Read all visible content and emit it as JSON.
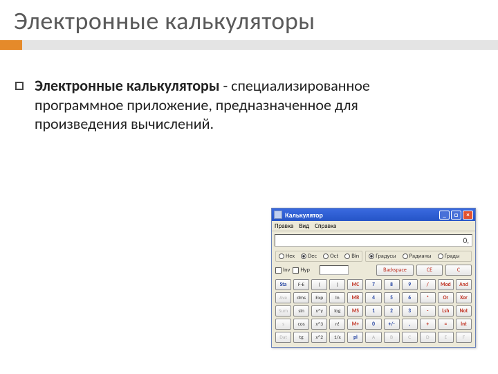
{
  "slide": {
    "title": "Электронные калькуляторы",
    "body_bold": "Электронные калькуляторы",
    "body_rest": " - специализированное программное приложение, предназначенное для произведения вычислений."
  },
  "calc": {
    "title": "Калькулятор",
    "menu": [
      "Правка",
      "Вид",
      "Справка"
    ],
    "display": "0,",
    "base": [
      {
        "label": "Hex",
        "sel": false
      },
      {
        "label": "Dec",
        "sel": true
      },
      {
        "label": "Oct",
        "sel": false
      },
      {
        "label": "Bin",
        "sel": false
      }
    ],
    "angle": [
      {
        "label": "Градусы",
        "sel": true
      },
      {
        "label": "Радианы",
        "sel": false
      },
      {
        "label": "Грады",
        "sel": false
      }
    ],
    "checks": [
      "Inv",
      "Hyp"
    ],
    "actions": [
      "Backspace",
      "CE",
      "C"
    ],
    "grid": [
      [
        {
          "t": "Sta",
          "c": "blue"
        },
        {
          "t": "F-E",
          "c": ""
        },
        {
          "t": "(",
          "c": ""
        },
        {
          "t": ")",
          "c": ""
        },
        {
          "t": "MC",
          "c": "red"
        },
        {
          "t": "7",
          "c": "blue"
        },
        {
          "t": "8",
          "c": "blue"
        },
        {
          "t": "9",
          "c": "blue"
        },
        {
          "t": "/",
          "c": "red"
        },
        {
          "t": "Mod",
          "c": "red"
        },
        {
          "t": "And",
          "c": "red"
        }
      ],
      [
        {
          "t": "Ave",
          "c": "dis"
        },
        {
          "t": "dms",
          "c": ""
        },
        {
          "t": "Exp",
          "c": ""
        },
        {
          "t": "ln",
          "c": ""
        },
        {
          "t": "MR",
          "c": "red"
        },
        {
          "t": "4",
          "c": "blue"
        },
        {
          "t": "5",
          "c": "blue"
        },
        {
          "t": "6",
          "c": "blue"
        },
        {
          "t": "*",
          "c": "red"
        },
        {
          "t": "Or",
          "c": "red"
        },
        {
          "t": "Xor",
          "c": "red"
        }
      ],
      [
        {
          "t": "Sum",
          "c": "dis"
        },
        {
          "t": "sin",
          "c": ""
        },
        {
          "t": "x^y",
          "c": ""
        },
        {
          "t": "log",
          "c": ""
        },
        {
          "t": "MS",
          "c": "red"
        },
        {
          "t": "1",
          "c": "blue"
        },
        {
          "t": "2",
          "c": "blue"
        },
        {
          "t": "3",
          "c": "blue"
        },
        {
          "t": "-",
          "c": "red"
        },
        {
          "t": "Lsh",
          "c": "red"
        },
        {
          "t": "Not",
          "c": "red"
        }
      ],
      [
        {
          "t": "s",
          "c": "dis"
        },
        {
          "t": "cos",
          "c": ""
        },
        {
          "t": "x^3",
          "c": ""
        },
        {
          "t": "n!",
          "c": ""
        },
        {
          "t": "M+",
          "c": "red"
        },
        {
          "t": "0",
          "c": "blue"
        },
        {
          "t": "+/-",
          "c": "blue"
        },
        {
          "t": ",",
          "c": "blue"
        },
        {
          "t": "+",
          "c": "red"
        },
        {
          "t": "=",
          "c": "red"
        },
        {
          "t": "Int",
          "c": "red"
        }
      ],
      [
        {
          "t": "Dat",
          "c": "dis"
        },
        {
          "t": "tg",
          "c": ""
        },
        {
          "t": "x^2",
          "c": ""
        },
        {
          "t": "1/x",
          "c": ""
        },
        {
          "t": "pi",
          "c": "blue"
        },
        {
          "t": "A",
          "c": "dis"
        },
        {
          "t": "B",
          "c": "dis"
        },
        {
          "t": "C",
          "c": "dis"
        },
        {
          "t": "D",
          "c": "dis"
        },
        {
          "t": "E",
          "c": "dis"
        },
        {
          "t": "F",
          "c": "dis"
        }
      ]
    ]
  }
}
